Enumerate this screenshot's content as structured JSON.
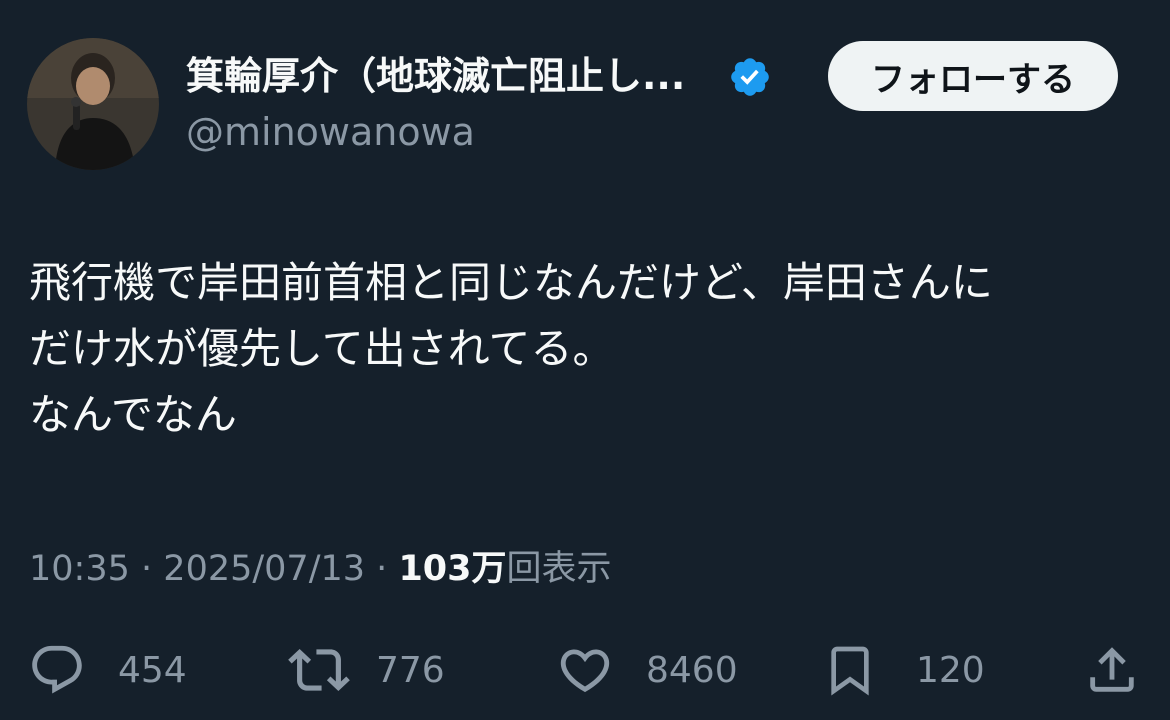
{
  "author": {
    "display_name": "箕輪厚介（地球滅亡阻止し...",
    "handle": "@minowanowa",
    "verified": true
  },
  "follow_button": {
    "label": "フォローする"
  },
  "tweet": {
    "lines": [
      "飛行機で岸田前首相と同じなんだけど、岸田さんに",
      "だけ水が優先して出されてる。",
      "なんでなん"
    ]
  },
  "meta": {
    "time": "10:35",
    "separator": "·",
    "date": "2025/07/13",
    "views_count": "103万",
    "views_label": "回表示"
  },
  "actions": {
    "replies": "454",
    "retweets": "776",
    "likes": "8460",
    "bookmarks": "120"
  },
  "icons": {
    "verified": "verified-badge-icon",
    "reply": "reply-bubble-icon",
    "retweet": "retweet-icon",
    "like": "heart-icon",
    "bookmark": "bookmark-icon",
    "share": "share-upload-icon"
  },
  "colors": {
    "background": "#15202b",
    "primary_text": "#f7f9f9",
    "secondary_text": "#8b98a5",
    "verified_blue": "#1d9bf0",
    "follow_bg": "#eff3f4"
  }
}
